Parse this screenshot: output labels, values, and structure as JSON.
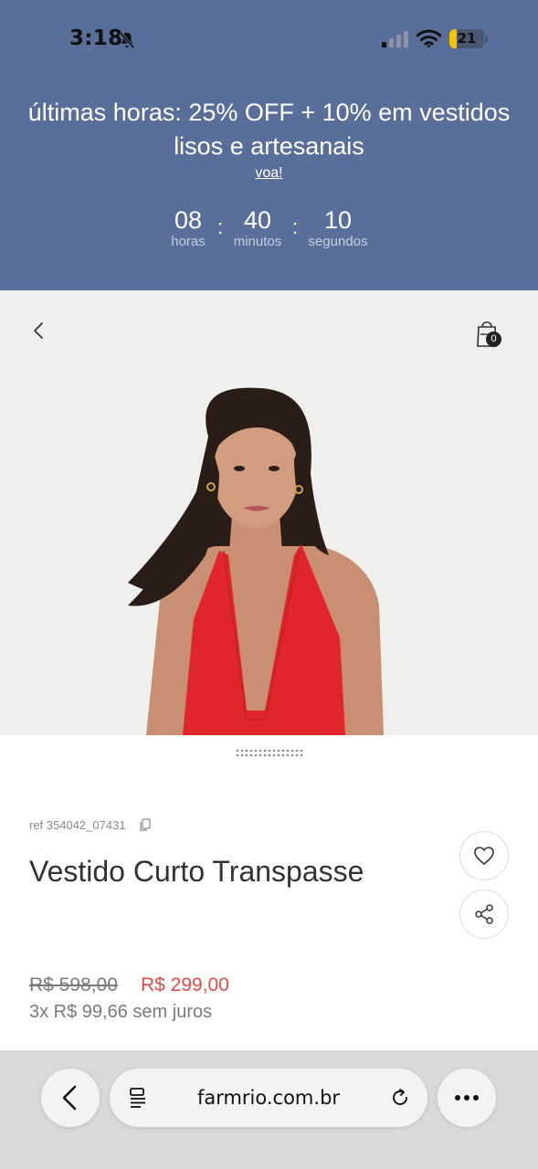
{
  "status_bar": {
    "time": "3:18",
    "battery": "21",
    "icons": [
      "bell-slash-icon",
      "signal-icon",
      "wifi-icon",
      "battery-icon"
    ]
  },
  "promo": {
    "title": "últimas horas: 25% OFF + 10% em vestidos lisos e artesanais",
    "link": "voa!",
    "countdown": {
      "hours": "08",
      "hours_label": "horas",
      "minutes": "40",
      "minutes_label": "minutos",
      "seconds": "10",
      "seconds_label": "segundos",
      "separator": ":"
    },
    "background": "#5a6e9a"
  },
  "product": {
    "bag_count": "0",
    "ref": "ref 354042_07431",
    "title": "Vestido Curto Transpasse",
    "price_old": "R$ 598,00",
    "price_new": "R$ 299,00",
    "installments": "3x R$ 99,66 sem juros",
    "sale_color": "#e04b45"
  },
  "browser": {
    "url": "farmrio.com.br"
  }
}
